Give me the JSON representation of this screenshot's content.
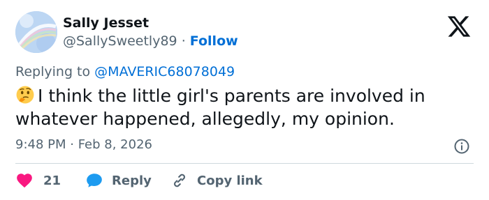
{
  "author": {
    "name": "Sally Jesset",
    "handle": "@SallySweetly89",
    "separator": "·",
    "follow_label": "Follow"
  },
  "platform_icon": "x-logo-icon",
  "replying": {
    "prefix": "Replying to",
    "mention": "@MAVERIC68078049"
  },
  "tweet": {
    "emoji": "thinking-face-icon",
    "text": "I think the little girl's parents are involved in whatever happened, allegedly, my opinion."
  },
  "meta": {
    "timestamp": "9:48 PM · Feb 8, 2026",
    "info_icon": "info-icon"
  },
  "actions": {
    "like_count": "21",
    "reply_label": "Reply",
    "copy_label": "Copy link"
  },
  "colors": {
    "text": "#0f1419",
    "secondary": "#536471",
    "link": "#006fd6",
    "like": "#f91880",
    "reply": "#1d9bf0",
    "divider": "#cfd9de"
  }
}
